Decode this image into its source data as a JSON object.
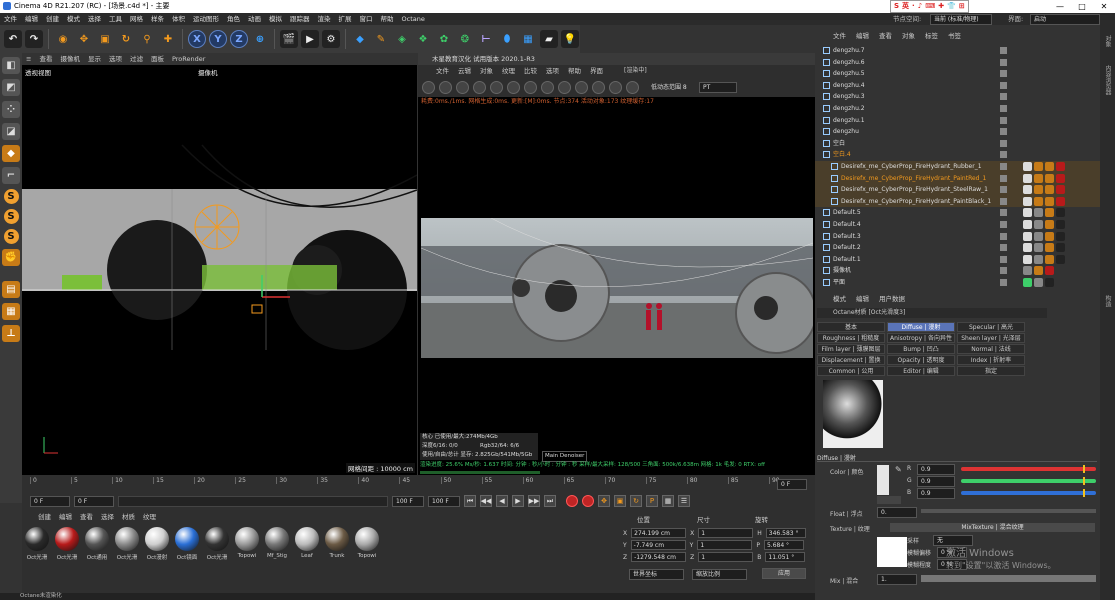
{
  "window": {
    "title": "Cinema 4D R21.207 (RC) - [场景.c4d *] - 主要",
    "controls": [
      "—",
      "□",
      "✕"
    ],
    "ime": [
      "S",
      "英",
      "·",
      "♪",
      "⌨",
      "✚",
      "👕",
      "⊞"
    ]
  },
  "menubar": {
    "items": [
      "文件",
      "编辑",
      "创建",
      "模式",
      "选择",
      "工具",
      "网格",
      "样条",
      "体积",
      "运动图形",
      "角色",
      "动画",
      "模拟",
      "跟踪器",
      "渲染",
      "扩展",
      "窗口",
      "帮助",
      "Octane"
    ],
    "node_space_label": "节点空间:",
    "node_space_value": "当前 (标准/物理)",
    "interface_label": "界面:",
    "interface_value": "启动"
  },
  "toolbar": {
    "icons": [
      "undo-icon",
      "redo-icon",
      "select-icon",
      "move-icon",
      "scale-icon",
      "rotate-icon",
      "recent-icon",
      "add-icon",
      "x-axis-icon",
      "y-axis-icon",
      "z-axis-icon",
      "coords-icon",
      "render-view-icon",
      "render-icon",
      "render-settings-icon",
      "cube-icon",
      "pen-icon",
      "subdivide-icon",
      "clone-icon",
      "deformer-icon",
      "mograph-icon",
      "range-icon",
      "camera-icon",
      "grid-icon",
      "scene-icon",
      "light-icon"
    ],
    "axis_labels": [
      "X",
      "Y",
      "Z"
    ]
  },
  "viewport": {
    "menu": [
      "查看",
      "摄像机",
      "显示",
      "选项",
      "过滤",
      "面板",
      "ProRender"
    ],
    "view_name": "透视视图",
    "camera_name": "摄像机",
    "grid_spacing": "网格间距 : 10000 cm"
  },
  "render_window": {
    "title": "木星教育汉化 试用版本 2020.1-R3",
    "menu": [
      "文件",
      "云辑",
      "对象",
      "纹理",
      "比较",
      "选项",
      "帮助",
      "界面"
    ],
    "status_badge": "[渲染中]",
    "mode_select": "低动态范围 8",
    "kernel_select": "PT",
    "status_line": "耗费:0ms./1ms. 网格生成:0ms. 更新:[M]:0ms. 节点:374 活动对象:173 纹理缓存:17",
    "info_lines": [
      "核心 已使用/最大:274Mb/4Gb",
      "深度6/16: 0/0",
      "Rgb32/64: 6/6",
      "使用/自由/总计 显存: 2.825Gb/541Mb/5Gb",
      "Main Denoiser",
      "渲染进度: 25.6%  Ms/秒: 1.637  时间: 分钟 : 秒/小时 : 分钟 : 秒  采样/最大采样: 128/500  三角面: 500k/6.638m  网格: 1k  毛发: 0  RTX: off"
    ]
  },
  "timeline": {
    "ticks": [
      "0",
      "5",
      "10",
      "15",
      "20",
      "25",
      "30",
      "35",
      "40",
      "45",
      "50",
      "55",
      "60",
      "65",
      "70",
      "75",
      "80",
      "85",
      "90"
    ],
    "frame_unit": "F",
    "current_frame": "0 F",
    "start_frame": "0 F",
    "end_frame": "100 F",
    "max_frame": "100 F",
    "frame_readout": "0 F",
    "playback_icons": [
      "⏮",
      "◀◀",
      "◀",
      "▶",
      "▶▶",
      "⏭"
    ]
  },
  "material_manager": {
    "tabs": [
      "创建",
      "编辑",
      "查看",
      "选择",
      "材质",
      "纹理"
    ],
    "materials": [
      {
        "name": "Oct光滑",
        "color": "#2a2a2a"
      },
      {
        "name": "Oct光滑",
        "color": "#b81a1a"
      },
      {
        "name": "Oct通用",
        "color": "#555555"
      },
      {
        "name": "Oct光滑",
        "color": "#8a8a8a"
      },
      {
        "name": "Oct漫射",
        "color": "#cfcfcf"
      },
      {
        "name": "Oct镜面",
        "color": "#2a6fd6"
      },
      {
        "name": "Oct光滑",
        "color": "#333333"
      },
      {
        "name": "Topowi",
        "color": "#9a9a9a"
      },
      {
        "name": "Mf_Stig",
        "color": "#777777"
      },
      {
        "name": "Leaf",
        "color": "#bbbbbb"
      },
      {
        "name": "Trunk",
        "color": "#6b5a45"
      },
      {
        "name": "Topowi",
        "color": "#aaaaaa"
      }
    ]
  },
  "coordinates": {
    "headers": [
      "位置",
      "尺寸",
      "旋转"
    ],
    "rows": [
      {
        "axis": "X",
        "pos": "274.199 cm",
        "size": "1",
        "rot_label": "H",
        "rot": "346.583 °"
      },
      {
        "axis": "Y",
        "pos": "-7.749 cm",
        "size": "1",
        "rot_label": "P",
        "rot": "5.684 °"
      },
      {
        "axis": "Z",
        "pos": "-1279.548 cm",
        "size": "1",
        "rot_label": "B",
        "rot": "11.051 °"
      }
    ],
    "mode_select": "世界坐标",
    "scale_select": "缩放比例",
    "apply_button": "应用"
  },
  "status_bar": "Octane未渲染化",
  "object_manager": {
    "tabs": [
      "文件",
      "编辑",
      "查看",
      "对象",
      "标签",
      "书签"
    ],
    "rows": [
      {
        "name": "dengzhu.7",
        "indent": 0,
        "selected": false,
        "orange": false,
        "tags": []
      },
      {
        "name": "dengzhu.6",
        "indent": 0,
        "selected": false,
        "orange": false,
        "tags": []
      },
      {
        "name": "dengzhu.5",
        "indent": 0,
        "selected": false,
        "orange": false,
        "tags": []
      },
      {
        "name": "dengzhu.4",
        "indent": 0,
        "selected": false,
        "orange": false,
        "tags": []
      },
      {
        "name": "dengzhu.3",
        "indent": 0,
        "selected": false,
        "orange": false,
        "tags": []
      },
      {
        "name": "dengzhu.2",
        "indent": 0,
        "selected": false,
        "orange": false,
        "tags": []
      },
      {
        "name": "dengzhu.1",
        "indent": 0,
        "selected": false,
        "orange": false,
        "tags": []
      },
      {
        "name": "dengzhu",
        "indent": 0,
        "selected": false,
        "orange": false,
        "tags": []
      },
      {
        "name": "空白",
        "indent": 0,
        "selected": false,
        "orange": false,
        "tags": []
      },
      {
        "name": "空白.4",
        "indent": 0,
        "selected": false,
        "orange": true,
        "tags": []
      },
      {
        "name": "Desirefx_me_CyberProp_FireHydrant_Rubber_1",
        "indent": 1,
        "selected": true,
        "orange": false,
        "tags": [
          "#ddd",
          "#c77b17",
          "#c77b17",
          "#b81a1a"
        ]
      },
      {
        "name": "Desirefx_me_CyberProp_FireHydrant_PaintRed_1",
        "indent": 1,
        "selected": true,
        "orange": true,
        "tags": [
          "#ddd",
          "#c77b17",
          "#c77b17",
          "#b81a1a"
        ]
      },
      {
        "name": "Desirefx_me_CyberProp_FireHydrant_SteelRaw_1",
        "indent": 1,
        "selected": true,
        "orange": false,
        "tags": [
          "#ddd",
          "#c77b17",
          "#c77b17",
          "#b81a1a"
        ]
      },
      {
        "name": "Desirefx_me_CyberProp_FireHydrant_PaintBlack_1",
        "indent": 1,
        "selected": true,
        "orange": false,
        "tags": [
          "#ddd",
          "#c77b17",
          "#c77b17",
          "#b81a1a"
        ]
      },
      {
        "name": "Default.5",
        "indent": 0,
        "selected": false,
        "orange": false,
        "tags": [
          "#ddd",
          "#888",
          "#c77b17",
          "#222"
        ]
      },
      {
        "name": "Default.4",
        "indent": 0,
        "selected": false,
        "orange": false,
        "tags": [
          "#ddd",
          "#888",
          "#c77b17",
          "#222"
        ]
      },
      {
        "name": "Default.3",
        "indent": 0,
        "selected": false,
        "orange": false,
        "tags": [
          "#ddd",
          "#888",
          "#c77b17",
          "#222"
        ]
      },
      {
        "name": "Default.2",
        "indent": 0,
        "selected": false,
        "orange": false,
        "tags": [
          "#ddd",
          "#888",
          "#c77b17",
          "#222"
        ]
      },
      {
        "name": "Default.1",
        "indent": 0,
        "selected": false,
        "orange": false,
        "tags": [
          "#ddd",
          "#888",
          "#c77b17",
          "#222"
        ]
      },
      {
        "name": "摄像机",
        "indent": 0,
        "selected": false,
        "orange": false,
        "tags": [
          "#888",
          "#c77b17",
          "#b81a1a"
        ]
      },
      {
        "name": "平面",
        "indent": 0,
        "selected": false,
        "orange": false,
        "tags": [
          "#3ecf6a",
          "#888",
          "#222"
        ]
      }
    ]
  },
  "attribute_manager": {
    "tabs": [
      "模式",
      "编辑",
      "用户数据"
    ],
    "material_title": "Octane材质 [Oct光滑度3]",
    "channel_tabs": [
      "基本",
      "Diffuse | 漫射",
      "Specular | 高光",
      "Roughness | 粗糙度",
      "Anisotropy | 各向异性",
      "Sheen layer | 光泽层",
      "Film layer | 薄膜图层",
      "Bump | 凹凸",
      "Normal | 法线",
      "Displacement | 置换",
      "Opacity | 透明度",
      "Index | 折射率",
      "Common | 公用",
      "Editor | 编辑",
      "指定"
    ],
    "section": "Diffuse | 漫射",
    "color_label": "Color | 颜色",
    "r_label": "R",
    "r_value": "0.9",
    "g_label": "G",
    "g_value": "0.9",
    "b_label": "B",
    "b_value": "0.9",
    "float_label": "Float | 浮点",
    "float_value": "0.",
    "texture_label": "Texture | 纹理",
    "texture_value": "MixTexture | 混合纹理",
    "sampling_label": "采样",
    "sampling_value": "无",
    "blur_offset_label": "模糊偏移",
    "blur_offset_value": "0 %",
    "blur_scale_label": "模糊程度",
    "blur_scale_value": "0 %",
    "mix_label": "Mix | 混合",
    "mix_value": "1.",
    "r_fraction": 0.9,
    "g_fraction": 0.9,
    "b_fraction": 0.9
  },
  "right_strip_labels": [
    "对象",
    "内容浏览器",
    "构造"
  ],
  "watermark": {
    "line1": "激活 Windows",
    "line2": "转到\"设置\"以激活 Windows。"
  },
  "colors": {
    "accent": "#5a74b8",
    "orange": "#f39a1e",
    "selected_row": "#4a3e2a",
    "record": "#c02525"
  }
}
